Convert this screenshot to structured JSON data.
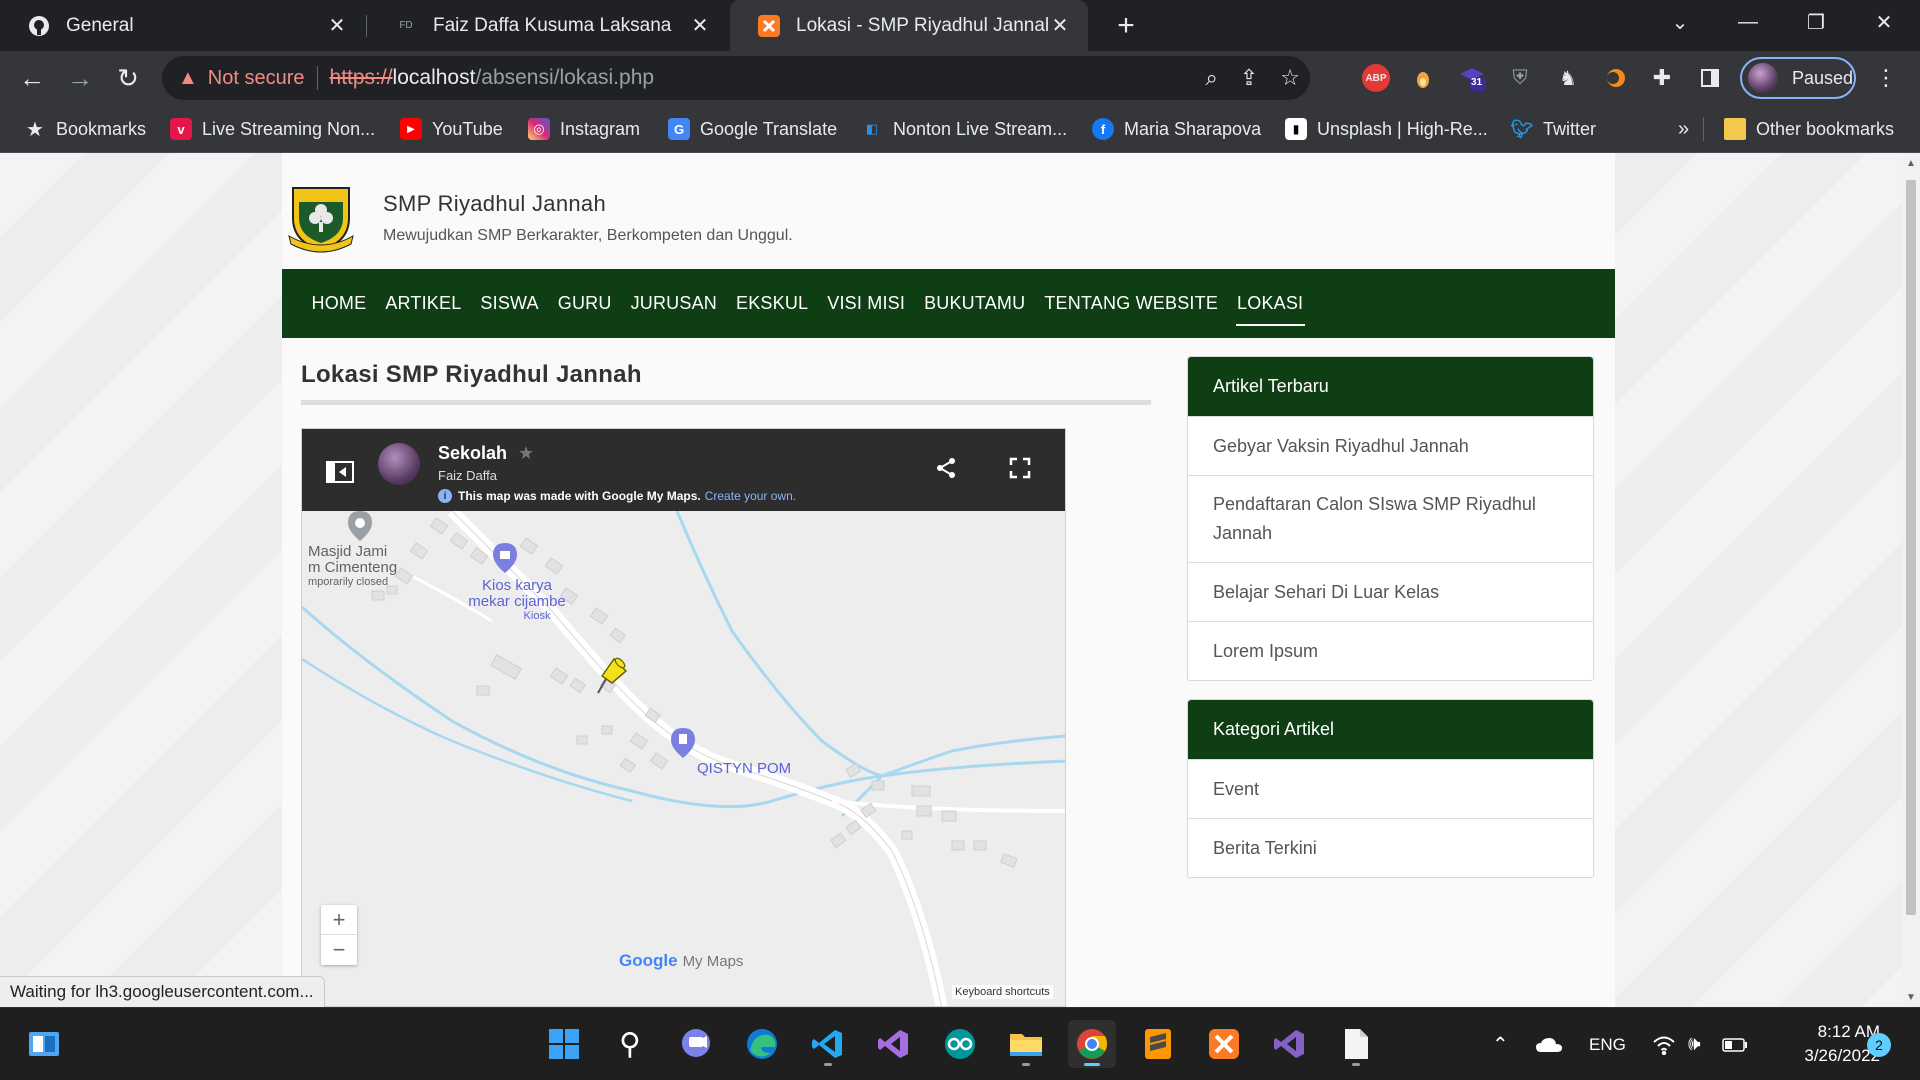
{
  "browser": {
    "tabs": [
      {
        "title": "General",
        "icon": "github-icon"
      },
      {
        "title": "Faiz Daffa Kusuma Laksana",
        "icon": "site-icon"
      },
      {
        "title": "Lokasi - SMP Riyadhul Jannah",
        "icon": "xampp-icon",
        "active": true
      }
    ],
    "address": {
      "security_label": "Not secure",
      "protocol": "https://",
      "host": "localhost",
      "path": "/absensi/lokasi.php"
    },
    "profile_label": "Paused",
    "extension_badge": "31",
    "extension_abp": "ABP",
    "bookmarks": [
      {
        "label": "Bookmarks",
        "icon": "star-icon"
      },
      {
        "label": "Live Streaming Non...",
        "icon": "vidio-icon"
      },
      {
        "label": "YouTube",
        "icon": "youtube-icon"
      },
      {
        "label": "Instagram",
        "icon": "instagram-icon"
      },
      {
        "label": "Google Translate",
        "icon": "translate-icon"
      },
      {
        "label": "Nonton Live Stream...",
        "icon": "stream-icon"
      },
      {
        "label": "Maria Sharapova",
        "icon": "facebook-icon"
      },
      {
        "label": "Unsplash | High-Re...",
        "icon": "unsplash-icon"
      },
      {
        "label": "Twitter",
        "icon": "twitter-icon"
      }
    ],
    "overflow_label": "»",
    "other_bookmarks": "Other bookmarks",
    "status_text": "Waiting for lh3.googleusercontent.com..."
  },
  "site": {
    "name": "SMP Riyadhul Jannah",
    "tagline": "Mewujudkan SMP Berkarakter, Berkompeten dan Unggul.",
    "nav": [
      "HOME",
      "ARTIKEL",
      "SISWA",
      "GURU",
      "JURUSAN",
      "EKSKUL",
      "VISI MISI",
      "BUKUTAMU",
      "TENTANG WEBSITE",
      "LOKASI"
    ],
    "active_nav": "LOKASI",
    "page_title": "Lokasi SMP Riyadhul Jannah",
    "sidebar": {
      "latest_title": "Artikel Terbaru",
      "latest": [
        "Gebyar Vaksin Riyadhul Jannah",
        "Pendaftaran Calon SIswa SMP Riyadhul Jannah",
        "Belajar Sehari Di Luar Kelas",
        "Lorem Ipsum"
      ],
      "category_title": "Kategori Artikel",
      "categories": [
        "Event",
        "Berita Terkini"
      ]
    }
  },
  "map": {
    "title": "Sekolah",
    "author": "Faiz Daffa",
    "notice": "This map was made with Google My Maps.",
    "notice_link": "Create your own.",
    "places": [
      {
        "name_line1": "Masjid Jami",
        "name_line2": "m Cimenteng",
        "note": "mporarily closed"
      },
      {
        "name_line1": "Kios karya",
        "name_line2": "mekar cijambe",
        "note": "Kiosk"
      },
      {
        "name_line1": "QISTYN POM",
        "name_line2": "",
        "note": ""
      }
    ],
    "zoom_in": "+",
    "zoom_out": "−",
    "brand_google": "Google",
    "brand_mymaps": "My Maps",
    "keyboard_shortcuts": "Keyboard shortcuts"
  },
  "taskbar": {
    "language": "ENG",
    "time": "8:12 AM",
    "date": "3/26/2022",
    "notification_count": "2",
    "apps": [
      "start-icon",
      "search-icon",
      "teams-chat-icon",
      "edge-icon",
      "vscode-icon",
      "visual-studio-icon",
      "arduino-icon",
      "file-explorer-icon",
      "chrome-icon",
      "sublime-icon",
      "xampp-icon",
      "visual-studio-icon",
      "file-icon"
    ]
  },
  "colors": {
    "nav_green": "#0f3d14",
    "browser_dark": "#202124",
    "toolbar": "#35363a",
    "warning_red": "#f28b82",
    "map_water": "#a8d8f0",
    "pin_yellow": "#f2e11b"
  }
}
